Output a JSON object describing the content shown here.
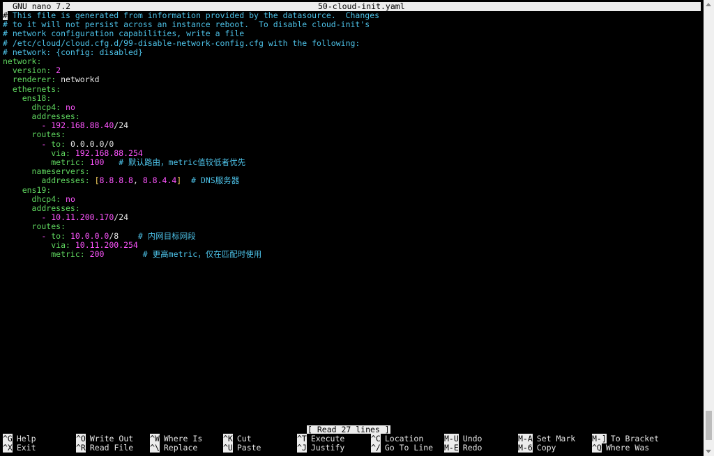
{
  "title_bar": {
    "app": "GNU nano 7.2",
    "file": "50-cloud-init.yaml"
  },
  "lines": [
    [
      {
        "t": "#",
        "c": "cursor"
      },
      {
        "t": " This file is generated from information provided by the datasource.  Changes",
        "c": "cm"
      }
    ],
    [
      {
        "t": "# to it will not persist across an instance reboot.  To disable cloud-init's",
        "c": "cm"
      }
    ],
    [
      {
        "t": "# network configuration capabilities, write a file",
        "c": "cm"
      }
    ],
    [
      {
        "t": "# /etc/cloud/cloud.cfg.d/99-disable-network-config.cfg with the following:",
        "c": "cm"
      }
    ],
    [
      {
        "t": "# network: {config: disabled}",
        "c": "cm"
      }
    ],
    [
      {
        "t": "network",
        "c": "key"
      },
      {
        "t": ":",
        "c": "key"
      }
    ],
    [
      {
        "t": "  version",
        "c": "key"
      },
      {
        "t": ": ",
        "c": "key"
      },
      {
        "t": "2",
        "c": "num"
      }
    ],
    [
      {
        "t": "  renderer",
        "c": "key"
      },
      {
        "t": ": ",
        "c": "key"
      },
      {
        "t": "networkd",
        "c": "pl"
      }
    ],
    [
      {
        "t": "  ethernets",
        "c": "key"
      },
      {
        "t": ":",
        "c": "key"
      }
    ],
    [
      {
        "t": "    ens18",
        "c": "key"
      },
      {
        "t": ":",
        "c": "key"
      }
    ],
    [
      {
        "t": "      dhcp4",
        "c": "key"
      },
      {
        "t": ": ",
        "c": "key"
      },
      {
        "t": "no",
        "c": "num"
      }
    ],
    [
      {
        "t": "      addresses",
        "c": "key"
      },
      {
        "t": ":",
        "c": "key"
      }
    ],
    [
      {
        "t": "        - ",
        "c": "num"
      },
      {
        "t": "192.168.88.40",
        "c": "num"
      },
      {
        "t": "/24",
        "c": "pl"
      }
    ],
    [
      {
        "t": "      routes",
        "c": "key"
      },
      {
        "t": ":",
        "c": "key"
      }
    ],
    [
      {
        "t": "        - ",
        "c": "num"
      },
      {
        "t": "to",
        "c": "key"
      },
      {
        "t": ": ",
        "c": "key"
      },
      {
        "t": "0.0.0.0/0",
        "c": "pl"
      }
    ],
    [
      {
        "t": "          via",
        "c": "key"
      },
      {
        "t": ": ",
        "c": "key"
      },
      {
        "t": "192.168.88.254",
        "c": "num"
      }
    ],
    [
      {
        "t": "          metric",
        "c": "key"
      },
      {
        "t": ": ",
        "c": "key"
      },
      {
        "t": "100",
        "c": "num"
      },
      {
        "t": "   # 默认路由，metric值较低者优先",
        "c": "cm"
      }
    ],
    [
      {
        "t": "      nameservers",
        "c": "key"
      },
      {
        "t": ":",
        "c": "key"
      }
    ],
    [
      {
        "t": "        addresses",
        "c": "key"
      },
      {
        "t": ": ",
        "c": "key"
      },
      {
        "t": "[",
        "c": "br"
      },
      {
        "t": "8.8.8.8",
        "c": "num"
      },
      {
        "t": ", ",
        "c": "pl"
      },
      {
        "t": "8.8.4.4",
        "c": "num"
      },
      {
        "t": "]",
        "c": "br"
      },
      {
        "t": "  # DNS服务器",
        "c": "cm"
      }
    ],
    [
      {
        "t": "    ens19",
        "c": "key"
      },
      {
        "t": ":",
        "c": "key"
      }
    ],
    [
      {
        "t": "      dhcp4",
        "c": "key"
      },
      {
        "t": ": ",
        "c": "key"
      },
      {
        "t": "no",
        "c": "num"
      }
    ],
    [
      {
        "t": "      addresses",
        "c": "key"
      },
      {
        "t": ":",
        "c": "key"
      }
    ],
    [
      {
        "t": "        - ",
        "c": "num"
      },
      {
        "t": "10.11.200.170",
        "c": "num"
      },
      {
        "t": "/24",
        "c": "pl"
      }
    ],
    [
      {
        "t": "      routes",
        "c": "key"
      },
      {
        "t": ":",
        "c": "key"
      }
    ],
    [
      {
        "t": "        - ",
        "c": "num"
      },
      {
        "t": "to",
        "c": "key"
      },
      {
        "t": ": ",
        "c": "key"
      },
      {
        "t": "10.0.0.0",
        "c": "num"
      },
      {
        "t": "/8",
        "c": "pl"
      },
      {
        "t": "    # 内网目标网段",
        "c": "cm"
      }
    ],
    [
      {
        "t": "          via",
        "c": "key"
      },
      {
        "t": ": ",
        "c": "key"
      },
      {
        "t": "10.11.200.254",
        "c": "num"
      }
    ],
    [
      {
        "t": "          metric",
        "c": "key"
      },
      {
        "t": ": ",
        "c": "key"
      },
      {
        "t": "200",
        "c": "num"
      },
      {
        "t": "        # 更高metric，仅在匹配时使用",
        "c": "cm"
      }
    ]
  ],
  "status": "[ Read 27 lines ]",
  "shortcuts": [
    [
      {
        "key": "^G",
        "label": "Help"
      },
      {
        "key": "^X",
        "label": "Exit"
      }
    ],
    [
      {
        "key": "^O",
        "label": "Write Out"
      },
      {
        "key": "^R",
        "label": "Read File"
      }
    ],
    [
      {
        "key": "^W",
        "label": "Where Is"
      },
      {
        "key": "^\\",
        "label": "Replace"
      }
    ],
    [
      {
        "key": "^K",
        "label": "Cut"
      },
      {
        "key": "^U",
        "label": "Paste"
      }
    ],
    [
      {
        "key": "^T",
        "label": "Execute"
      },
      {
        "key": "^J",
        "label": "Justify"
      }
    ],
    [
      {
        "key": "^C",
        "label": "Location"
      },
      {
        "key": "^/",
        "label": "Go To Line"
      }
    ],
    [
      {
        "key": "M-U",
        "label": "Undo"
      },
      {
        "key": "M-E",
        "label": "Redo"
      }
    ],
    [
      {
        "key": "M-A",
        "label": "Set Mark"
      },
      {
        "key": "M-6",
        "label": "Copy"
      }
    ],
    [
      {
        "key": "M-]",
        "label": "To Bracket"
      },
      {
        "key": "^Q",
        "label": "Where Was"
      }
    ]
  ]
}
